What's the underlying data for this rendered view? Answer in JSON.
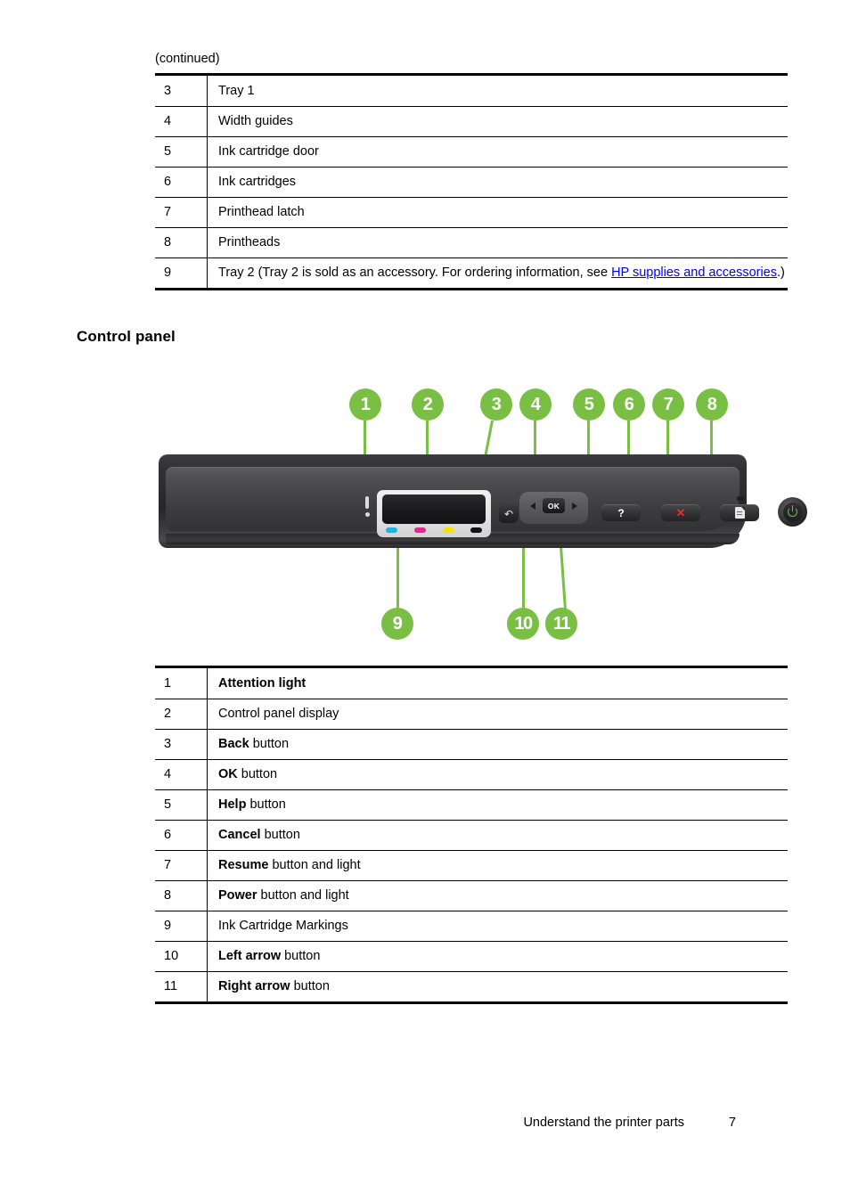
{
  "document": {
    "continued_label": "(continued)",
    "section_heading": "Control panel"
  },
  "parts_table": {
    "rows": [
      {
        "num": "3",
        "text": "Tray 1"
      },
      {
        "num": "4",
        "text": "Width guides"
      },
      {
        "num": "5",
        "text": "Ink cartridge door"
      },
      {
        "num": "6",
        "text": "Ink cartridges"
      },
      {
        "num": "7",
        "text": "Printhead latch"
      },
      {
        "num": "8",
        "text": "Printheads"
      },
      {
        "num": "9",
        "text": "Tray 2 (Tray 2 is sold as an accessory. For ordering information, see ",
        "link": "HP supplies and accessories",
        "text_after": ".)"
      }
    ]
  },
  "panel_table": {
    "rows": [
      {
        "num": "1",
        "bold": "Attention light",
        "rest": ""
      },
      {
        "num": "2",
        "bold": "",
        "rest": "Control panel display"
      },
      {
        "num": "3",
        "bold": "Back",
        "rest": " button"
      },
      {
        "num": "4",
        "bold": "OK",
        "rest": " button"
      },
      {
        "num": "5",
        "bold": "Help",
        "rest": " button"
      },
      {
        "num": "6",
        "bold": "Cancel",
        "rest": " button"
      },
      {
        "num": "7",
        "bold": "Resume",
        "rest": " button and light"
      },
      {
        "num": "8",
        "bold": "Power",
        "rest": " button and light"
      },
      {
        "num": "9",
        "bold": "",
        "rest": "Ink Cartridge Markings"
      },
      {
        "num": "10",
        "bold": "Left arrow",
        "rest": " button"
      },
      {
        "num": "11",
        "bold": "Right arrow",
        "rest": " button"
      }
    ]
  },
  "figure": {
    "callouts": [
      {
        "id": "1",
        "label": "1",
        "target": "attention-light"
      },
      {
        "id": "2",
        "label": "2",
        "target": "control-panel-display"
      },
      {
        "id": "3",
        "label": "3",
        "target": "back-button"
      },
      {
        "id": "4",
        "label": "4",
        "target": "ok-button"
      },
      {
        "id": "5",
        "label": "5",
        "target": "help-button"
      },
      {
        "id": "6",
        "label": "6",
        "target": "cancel-button"
      },
      {
        "id": "7",
        "label": "7",
        "target": "resume-button"
      },
      {
        "id": "8",
        "label": "8",
        "target": "power-button"
      },
      {
        "id": "9",
        "label": "9",
        "target": "ink-cartridge-markings"
      },
      {
        "id": "10",
        "label": "10",
        "target": "left-arrow-button"
      },
      {
        "id": "11",
        "label": "11",
        "target": "right-arrow-button"
      }
    ],
    "buttons": {
      "ok_label": "OK",
      "help_label": "?",
      "cancel_label": "✕",
      "back_label": "↶"
    },
    "ink_marks": [
      {
        "name": "cyan",
        "color": "#18b6e0"
      },
      {
        "name": "magenta",
        "color": "#e8268f"
      },
      {
        "name": "yellow",
        "color": "#f3e500"
      },
      {
        "name": "black",
        "color": "#131315"
      }
    ],
    "colors": {
      "callout_green": "#79bf43",
      "power_green": "#6cc04a",
      "cancel_red": "#e03131"
    }
  },
  "footer": {
    "label": "Understand the printer parts",
    "page_number": "7"
  }
}
